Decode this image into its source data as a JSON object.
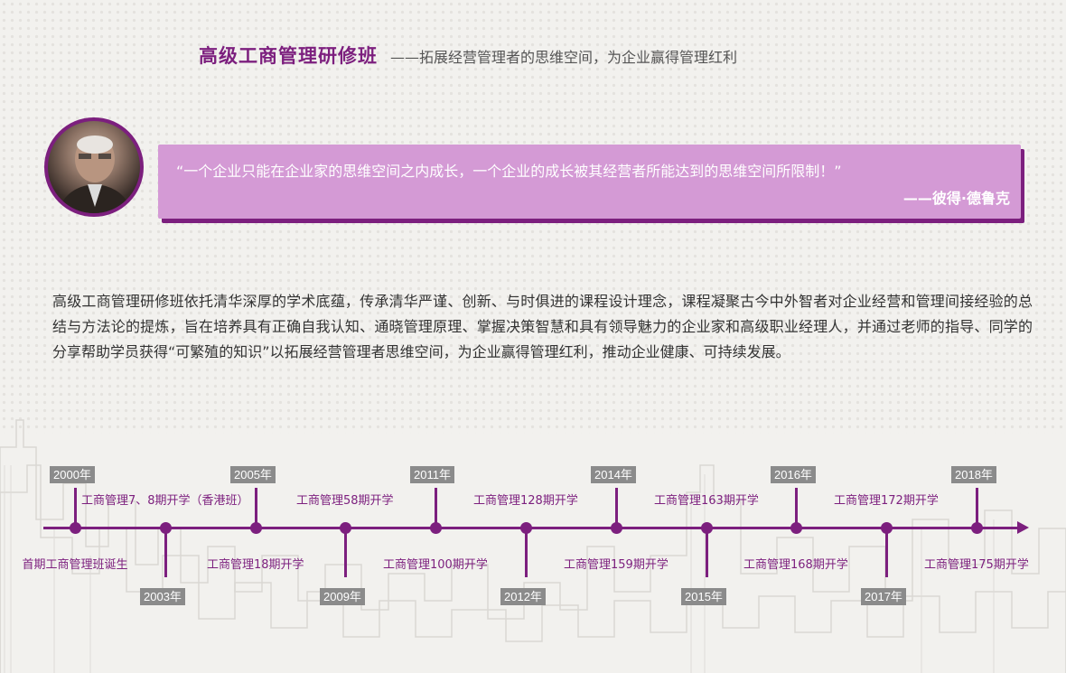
{
  "header": {
    "title": "高级工商管理研修班",
    "subtitle": "——拓展经营管理者的思维空间，为企业赢得管理红利"
  },
  "quote": {
    "text": "“一个企业只能在企业家的思维空间之内成长，一个企业的成长被其经营者所能达到的思维空间所限制！”",
    "author": "——彼得·德鲁克"
  },
  "description": "高级工商管理研修班依托清华深厚的学术底蕴，传承清华严谨、创新、与时俱进的课程设计理念，课程凝聚古今中外智者对企业经营和管理间接经验的总结与方法论的提炼，旨在培养具有正确自我认知、通晓管理原理、掌握决策智慧和具有领导魅力的企业家和高级职业经理人，并通过老师的指导、同学的分享帮助学员获得“可繁殖的知识”以拓展经营管理者思维空间，为企业赢得管理红利，推动企业健康、可持续发展。",
  "timeline": [
    {
      "year": "2000年",
      "event": "首期工商管理班诞生",
      "side": "up"
    },
    {
      "year": "2003年",
      "event": "工商管理7、8期开学（香港班）",
      "side": "down"
    },
    {
      "year": "2005年",
      "event": "工商管理18期开学",
      "side": "up"
    },
    {
      "year": "2009年",
      "event": "工商管理58期开学",
      "side": "down"
    },
    {
      "year": "2011年",
      "event": "工商管理100期开学",
      "side": "up"
    },
    {
      "year": "2012年",
      "event": "工商管理128期开学",
      "side": "down"
    },
    {
      "year": "2014年",
      "event": "工商管理159期开学",
      "side": "up"
    },
    {
      "year": "2015年",
      "event": "工商管理163期开学",
      "side": "down"
    },
    {
      "year": "2016年",
      "event": "工商管理168期开学",
      "side": "up"
    },
    {
      "year": "2017年",
      "event": "工商管理172期开学",
      "side": "down"
    },
    {
      "year": "2018年",
      "event": "工商管理175期开学",
      "side": "up"
    }
  ],
  "colors": {
    "accent": "#7c1f7e",
    "quote_bg": "#d49ad5",
    "year_badge": "#8b8b8b",
    "background": "#f2f1ee"
  }
}
